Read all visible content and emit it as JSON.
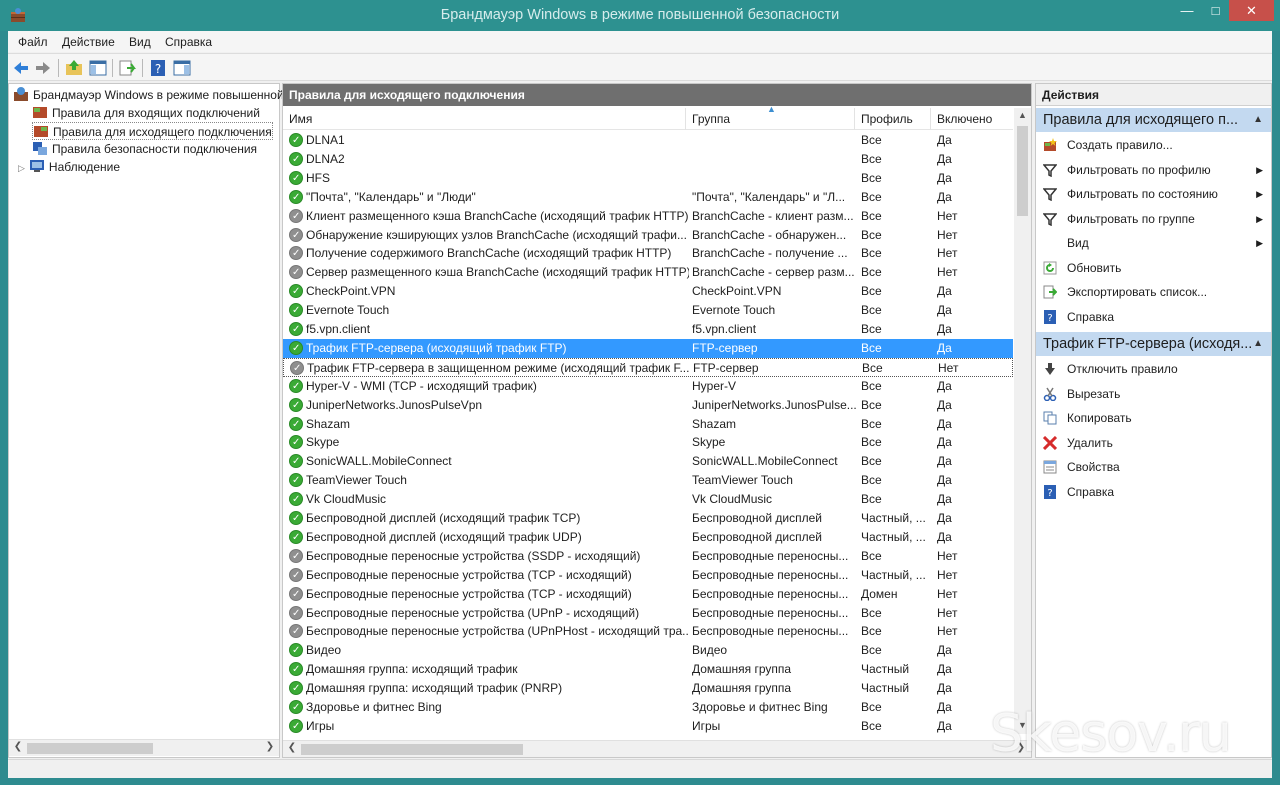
{
  "window": {
    "title": "Брандмауэр Windows в режиме повышенной безопасности"
  },
  "menu": [
    "Файл",
    "Действие",
    "Вид",
    "Справка"
  ],
  "tree": {
    "root": "Брандмауэр Windows в режиме повышенной безопасности",
    "items": [
      "Правила для входящих подключений",
      "Правила для исходящего подключения",
      "Правила безопасности подключения",
      "Наблюдение"
    ]
  },
  "center": {
    "header": "Правила для исходящего подключения",
    "columns": {
      "name": "Имя",
      "group": "Группа",
      "profile": "Профиль",
      "enabled": "Включено"
    },
    "rows": [
      {
        "name": "DLNA1",
        "group": "",
        "profile": "Все",
        "enabled": "Да",
        "status": "on"
      },
      {
        "name": "DLNA2",
        "group": "",
        "profile": "Все",
        "enabled": "Да",
        "status": "on"
      },
      {
        "name": "HFS",
        "group": "",
        "profile": "Все",
        "enabled": "Да",
        "status": "on"
      },
      {
        "name": "\"Почта\", \"Календарь\" и \"Люди\"",
        "group": "\"Почта\", \"Календарь\" и \"Л...",
        "profile": "Все",
        "enabled": "Да",
        "status": "on"
      },
      {
        "name": "Клиент размещенного кэша BranchCache (исходящий трафик HTTP)",
        "group": "BranchCache - клиент разм...",
        "profile": "Все",
        "enabled": "Нет",
        "status": "off"
      },
      {
        "name": "Обнаружение кэширующих узлов BranchCache (исходящий трафи...",
        "group": "BranchCache - обнаружен...",
        "profile": "Все",
        "enabled": "Нет",
        "status": "off"
      },
      {
        "name": "Получение содержимого BranchCache (исходящий трафик HTTP)",
        "group": "BranchCache - получение ...",
        "profile": "Все",
        "enabled": "Нет",
        "status": "off"
      },
      {
        "name": "Сервер размещенного кэша BranchCache (исходящий трафик HTTP)",
        "group": "BranchCache - сервер разм...",
        "profile": "Все",
        "enabled": "Нет",
        "status": "off"
      },
      {
        "name": "CheckPoint.VPN",
        "group": "CheckPoint.VPN",
        "profile": "Все",
        "enabled": "Да",
        "status": "on"
      },
      {
        "name": "Evernote Touch",
        "group": "Evernote Touch",
        "profile": "Все",
        "enabled": "Да",
        "status": "on"
      },
      {
        "name": "f5.vpn.client",
        "group": "f5.vpn.client",
        "profile": "Все",
        "enabled": "Да",
        "status": "on"
      },
      {
        "name": "Трафик FTP-сервера (исходящий трафик FTP)",
        "group": "FTP-сервер",
        "profile": "Все",
        "enabled": "Да",
        "status": "on",
        "selected": true
      },
      {
        "name": "Трафик FTP-сервера в защищенном режиме (исходящий трафик F...",
        "group": "FTP-сервер",
        "profile": "Все",
        "enabled": "Нет",
        "status": "off",
        "focused": true
      },
      {
        "name": "Hyper-V - WMI (TCP - исходящий трафик)",
        "group": "Hyper-V",
        "profile": "Все",
        "enabled": "Да",
        "status": "on"
      },
      {
        "name": "JuniperNetworks.JunosPulseVpn",
        "group": "JuniperNetworks.JunosPulse...",
        "profile": "Все",
        "enabled": "Да",
        "status": "on"
      },
      {
        "name": "Shazam",
        "group": "Shazam",
        "profile": "Все",
        "enabled": "Да",
        "status": "on"
      },
      {
        "name": "Skype",
        "group": "Skype",
        "profile": "Все",
        "enabled": "Да",
        "status": "on"
      },
      {
        "name": "SonicWALL.MobileConnect",
        "group": "SonicWALL.MobileConnect",
        "profile": "Все",
        "enabled": "Да",
        "status": "on"
      },
      {
        "name": "TeamViewer Touch",
        "group": "TeamViewer Touch",
        "profile": "Все",
        "enabled": "Да",
        "status": "on"
      },
      {
        "name": "Vk CloudMusic",
        "group": "Vk CloudMusic",
        "profile": "Все",
        "enabled": "Да",
        "status": "on"
      },
      {
        "name": "Беспроводной дисплей (исходящий трафик TCP)",
        "group": "Беспроводной дисплей",
        "profile": "Частный, ...",
        "enabled": "Да",
        "status": "on"
      },
      {
        "name": "Беспроводной дисплей (исходящий трафик UDP)",
        "group": "Беспроводной дисплей",
        "profile": "Частный, ...",
        "enabled": "Да",
        "status": "on"
      },
      {
        "name": "Беспроводные переносные устройства (SSDP - исходящий)",
        "group": "Беспроводные переносны...",
        "profile": "Все",
        "enabled": "Нет",
        "status": "off"
      },
      {
        "name": "Беспроводные переносные устройства (TCP - исходящий)",
        "group": "Беспроводные переносны...",
        "profile": "Частный, ...",
        "enabled": "Нет",
        "status": "off"
      },
      {
        "name": "Беспроводные переносные устройства (TCP - исходящий)",
        "group": "Беспроводные переносны...",
        "profile": "Домен",
        "enabled": "Нет",
        "status": "off"
      },
      {
        "name": "Беспроводные переносные устройства (UPnP - исходящий)",
        "group": "Беспроводные переносны...",
        "profile": "Все",
        "enabled": "Нет",
        "status": "off"
      },
      {
        "name": "Беспроводные переносные устройства (UPnPHost - исходящий тра...",
        "group": "Беспроводные переносны...",
        "profile": "Все",
        "enabled": "Нет",
        "status": "off"
      },
      {
        "name": "Видео",
        "group": "Видео",
        "profile": "Все",
        "enabled": "Да",
        "status": "on"
      },
      {
        "name": "Домашняя группа: исходящий трафик",
        "group": "Домашняя группа",
        "profile": "Частный",
        "enabled": "Да",
        "status": "on"
      },
      {
        "name": "Домашняя группа: исходящий трафик (PNRP)",
        "group": "Домашняя группа",
        "profile": "Частный",
        "enabled": "Да",
        "status": "on"
      },
      {
        "name": "Здоровье и фитнес Bing",
        "group": "Здоровье и фитнес Bing",
        "profile": "Все",
        "enabled": "Да",
        "status": "on"
      },
      {
        "name": "Игры",
        "group": "Игры",
        "profile": "Все",
        "enabled": "Да",
        "status": "on"
      }
    ]
  },
  "actions": {
    "title": "Действия",
    "section1": "Правила для исходящего п...",
    "section1_items": [
      {
        "label": "Создать правило...",
        "icon": "new-rule-icon",
        "submenu": false
      },
      {
        "label": "Фильтровать по профилю",
        "icon": "filter-icon",
        "submenu": true
      },
      {
        "label": "Фильтровать по состоянию",
        "icon": "filter-icon",
        "submenu": true
      },
      {
        "label": "Фильтровать по группе",
        "icon": "filter-icon",
        "submenu": true
      },
      {
        "label": "Вид",
        "icon": "",
        "submenu": true
      },
      {
        "label": "Обновить",
        "icon": "refresh-icon",
        "submenu": false
      },
      {
        "label": "Экспортировать список...",
        "icon": "export-icon",
        "submenu": false
      },
      {
        "label": "Справка",
        "icon": "help-icon",
        "submenu": false
      }
    ],
    "section2": "Трафик FTP-сервера (исходя...",
    "section2_items": [
      {
        "label": "Отключить правило",
        "icon": "disable-rule-icon"
      },
      {
        "label": "Вырезать",
        "icon": "cut-icon"
      },
      {
        "label": "Копировать",
        "icon": "copy-icon"
      },
      {
        "label": "Удалить",
        "icon": "delete-icon"
      },
      {
        "label": "Свойства",
        "icon": "properties-icon"
      },
      {
        "label": "Справка",
        "icon": "help-icon"
      }
    ]
  },
  "watermark": "Skesov.ru",
  "colors": {
    "titlebar": "#2d9190",
    "selection": "#3399ff",
    "section": "#c3d9f0",
    "close": "#c7504a"
  }
}
